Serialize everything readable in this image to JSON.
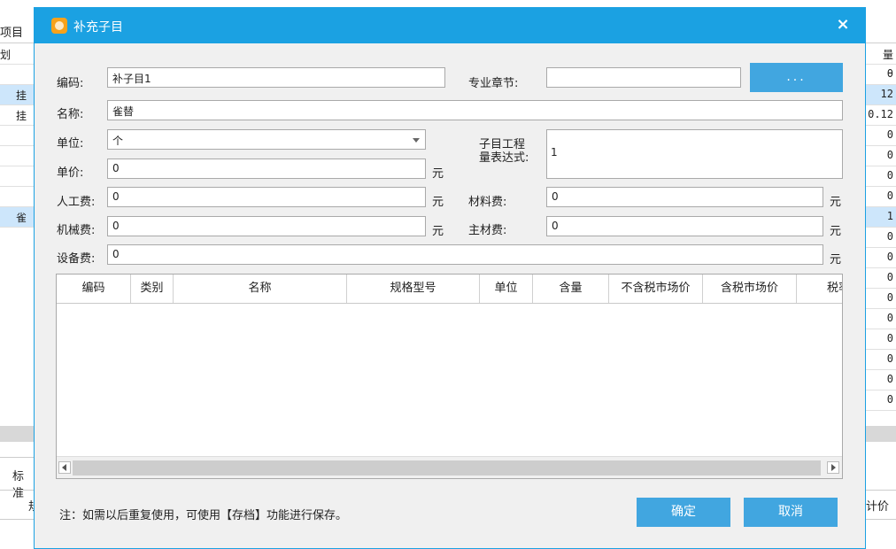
{
  "background": {
    "top_tab": "项目",
    "left_header": "划",
    "left_rows": [
      {
        "text": "",
        "selected": false
      },
      {
        "text": "挂",
        "selected": true
      },
      {
        "text": "挂",
        "selected": false
      },
      {
        "text": "",
        "selected": false
      },
      {
        "text": "",
        "selected": false
      },
      {
        "text": "",
        "selected": false
      },
      {
        "text": "",
        "selected": false
      },
      {
        "text": "雀",
        "selected": true
      }
    ],
    "right_header": "量",
    "right_values": [
      "θ",
      "12",
      "0.12",
      "0",
      "0",
      "0",
      "0",
      "1",
      "0",
      "0",
      "0",
      "0",
      "0",
      "0",
      "0",
      "0",
      "0"
    ],
    "right_selected": [
      1,
      7
    ],
    "bottom_tab": "标准",
    "bottom_left_text": "规",
    "bottom_right_text": "计价"
  },
  "dialog": {
    "title": "补充子目",
    "close_label": "×",
    "fields": {
      "code_label": "编码:",
      "code_value": "补子目1",
      "chapter_label": "专业章节:",
      "chapter_value": "",
      "chapter_button": "...",
      "name_label": "名称:",
      "name_value": "雀替",
      "unit_label": "单位:",
      "unit_value": "个",
      "expr_label_1": "子目工程",
      "expr_label_2": "量表达式:",
      "expr_value": "1",
      "price_label": "单价:",
      "price_value": "0",
      "labor_label": "人工费:",
      "labor_value": "0",
      "material_label": "材料费:",
      "material_value": "0",
      "machine_label": "机械费:",
      "machine_value": "0",
      "main_material_label": "主材费:",
      "main_material_value": "0",
      "equipment_label": "设备费:",
      "equipment_value": "0",
      "currency": "元"
    },
    "grid": {
      "columns": [
        "编码",
        "类别",
        "名称",
        "规格型号",
        "单位",
        "含量",
        "不含税市场价",
        "含税市场价",
        "税率"
      ]
    },
    "note": "注：如需以后重复使用，可使用【存档】功能进行保存。",
    "ok_label": "确定",
    "cancel_label": "取消"
  }
}
